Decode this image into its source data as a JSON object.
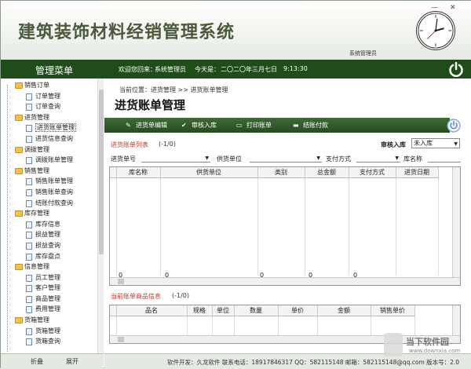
{
  "app": {
    "title": "建筑装饰材料经销管理系统",
    "minimize": "—",
    "close": "✕",
    "system_user": "系统管理员"
  },
  "topbar": {
    "menu_title": "管理菜单",
    "welcome_label": "欢迎您回来：",
    "welcome_user": "系统管理员",
    "date_label": "今天是：",
    "date_value": "二〇二〇年三月七日",
    "time": "9:13:30"
  },
  "sidebar": {
    "tree": [
      {
        "label": "销售订单",
        "type": "cat"
      },
      {
        "label": "订单管理",
        "type": "item"
      },
      {
        "label": "订单查询",
        "type": "item"
      },
      {
        "label": "进货管理",
        "type": "cat"
      },
      {
        "label": "进货账单管理",
        "type": "item",
        "selected": true
      },
      {
        "label": "进货信息查询",
        "type": "item"
      },
      {
        "label": "调拨管理",
        "type": "cat"
      },
      {
        "label": "调拨账单管理",
        "type": "item"
      },
      {
        "label": "销售管理",
        "type": "cat"
      },
      {
        "label": "销售账单管理",
        "type": "item"
      },
      {
        "label": "销售账单查询",
        "type": "item"
      },
      {
        "label": "结账付款查询",
        "type": "item"
      },
      {
        "label": "库存管理",
        "type": "cat"
      },
      {
        "label": "库存信息",
        "type": "item"
      },
      {
        "label": "损益管理",
        "type": "item"
      },
      {
        "label": "损益查询",
        "type": "item"
      },
      {
        "label": "库存盘点",
        "type": "item"
      },
      {
        "label": "信息管理",
        "type": "cat"
      },
      {
        "label": "员工管理",
        "type": "item"
      },
      {
        "label": "客户管理",
        "type": "item"
      },
      {
        "label": "商品管理",
        "type": "item"
      },
      {
        "label": "费用管理",
        "type": "item"
      },
      {
        "label": "货箱管理",
        "type": "cat"
      },
      {
        "label": "货箱管理",
        "type": "item"
      },
      {
        "label": "货箱查询",
        "type": "item"
      }
    ],
    "collapse_label": "折叠",
    "expand_label": "展开"
  },
  "main": {
    "breadcrumb": "当前位置：进货管理 >> 进货账单管理",
    "page_title": "进货账单管理",
    "toolbar": {
      "edit": "进货单编辑",
      "approve": "审核入库",
      "print": "打印账单",
      "settle": "结账付款"
    },
    "list_section": {
      "title": "进货账单列表",
      "count": "(-1/0)",
      "approve_filter_label": "审核入库",
      "approve_filter_value": "未入库"
    },
    "filters": {
      "order_no": "进货单号",
      "supplier": "供货单位",
      "payment": "支付方式",
      "warehouse": "库名称"
    },
    "list_table": {
      "columns": [
        "库名称",
        "供货单位",
        "类别",
        "总金额",
        "支付方式",
        "进货日期"
      ],
      "totals": [
        "0",
        "0",
        "0",
        "0",
        "0"
      ]
    },
    "detail_section": {
      "title": "当前账单商品信息",
      "count": "(-1/0)"
    },
    "detail_table": {
      "columns": [
        "品名",
        "规格",
        "单位",
        "数量",
        "单价",
        "金额",
        "销售单价"
      ]
    }
  },
  "footer": {
    "text": "软件开发：久龙软件    联系电话：18917846317    QQ：582115148    邮箱：582115148@qq.com    版本号：2.0"
  },
  "watermark": {
    "name": "当下软件园",
    "url": "www.downxia.com"
  },
  "colors": {
    "green_bar": "#1f4d1a",
    "toolbar": "#284a22",
    "section_title": "#c0392b"
  }
}
